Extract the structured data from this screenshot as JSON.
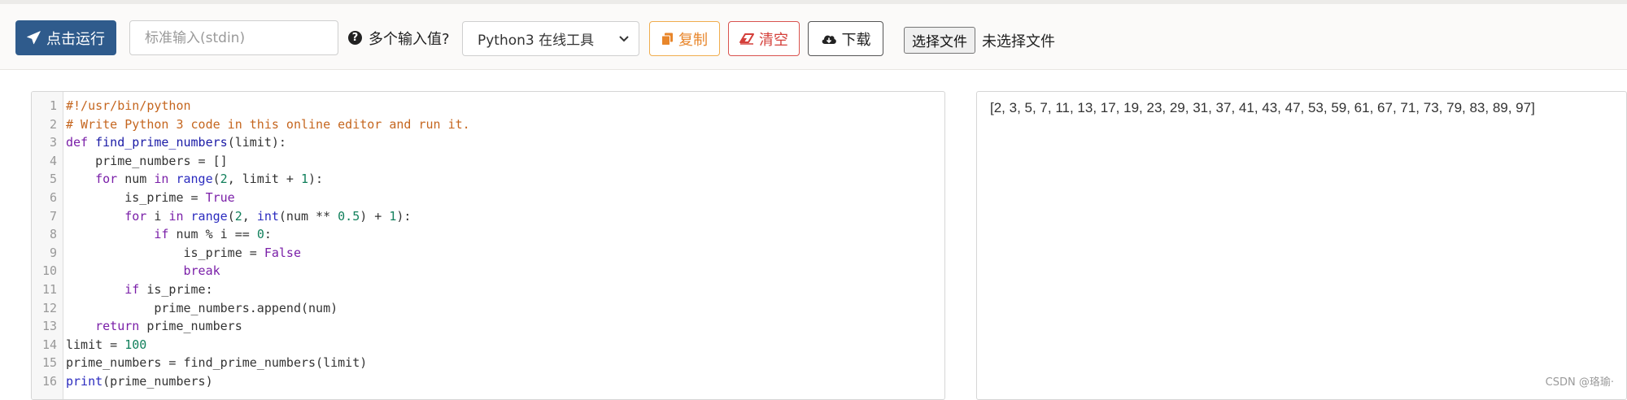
{
  "toolbar": {
    "run_label": "点击运行",
    "stdin_placeholder": "标准输入(stdin)",
    "multi_input_label": "多个输入值?",
    "language_selected": "Python3 在线工具",
    "copy_label": "复制",
    "clear_label": "清空",
    "download_label": "下载",
    "file_button_label": "选择文件",
    "file_status": "未选择文件"
  },
  "editor": {
    "lines": [
      {
        "n": "1",
        "tokens": [
          {
            "t": "#!/usr/bin/python",
            "c": "comment"
          }
        ]
      },
      {
        "n": "2",
        "tokens": [
          {
            "t": "# Write Python 3 code in this online editor and run it.",
            "c": "comment"
          }
        ]
      },
      {
        "n": "3",
        "tokens": [
          {
            "t": "def ",
            "c": "keyword"
          },
          {
            "t": "find_prime_numbers",
            "c": "def"
          },
          {
            "t": "(limit):",
            "c": ""
          }
        ]
      },
      {
        "n": "4",
        "tokens": [
          {
            "t": "    prime_numbers = []",
            "c": ""
          }
        ]
      },
      {
        "n": "5",
        "tokens": [
          {
            "t": "    ",
            "c": ""
          },
          {
            "t": "for",
            "c": "keyword"
          },
          {
            "t": " num ",
            "c": ""
          },
          {
            "t": "in",
            "c": "keyword"
          },
          {
            "t": " ",
            "c": ""
          },
          {
            "t": "range",
            "c": "builtin"
          },
          {
            "t": "(",
            "c": ""
          },
          {
            "t": "2",
            "c": "number"
          },
          {
            "t": ", limit + ",
            "c": ""
          },
          {
            "t": "1",
            "c": "number"
          },
          {
            "t": "):",
            "c": ""
          }
        ]
      },
      {
        "n": "6",
        "tokens": [
          {
            "t": "        is_prime = ",
            "c": ""
          },
          {
            "t": "True",
            "c": "keyword"
          }
        ]
      },
      {
        "n": "7",
        "tokens": [
          {
            "t": "        ",
            "c": ""
          },
          {
            "t": "for",
            "c": "keyword"
          },
          {
            "t": " i ",
            "c": ""
          },
          {
            "t": "in",
            "c": "keyword"
          },
          {
            "t": " ",
            "c": ""
          },
          {
            "t": "range",
            "c": "builtin"
          },
          {
            "t": "(",
            "c": ""
          },
          {
            "t": "2",
            "c": "number"
          },
          {
            "t": ", ",
            "c": ""
          },
          {
            "t": "int",
            "c": "builtin"
          },
          {
            "t": "(num ** ",
            "c": ""
          },
          {
            "t": "0.5",
            "c": "number"
          },
          {
            "t": ") + ",
            "c": ""
          },
          {
            "t": "1",
            "c": "number"
          },
          {
            "t": "):",
            "c": ""
          }
        ]
      },
      {
        "n": "8",
        "tokens": [
          {
            "t": "            ",
            "c": ""
          },
          {
            "t": "if",
            "c": "keyword"
          },
          {
            "t": " num % i == ",
            "c": ""
          },
          {
            "t": "0",
            "c": "number"
          },
          {
            "t": ":",
            "c": ""
          }
        ]
      },
      {
        "n": "9",
        "tokens": [
          {
            "t": "                is_prime = ",
            "c": ""
          },
          {
            "t": "False",
            "c": "keyword"
          }
        ]
      },
      {
        "n": "10",
        "tokens": [
          {
            "t": "                ",
            "c": ""
          },
          {
            "t": "break",
            "c": "keyword"
          }
        ]
      },
      {
        "n": "11",
        "tokens": [
          {
            "t": "        ",
            "c": ""
          },
          {
            "t": "if",
            "c": "keyword"
          },
          {
            "t": " is_prime:",
            "c": ""
          }
        ]
      },
      {
        "n": "12",
        "tokens": [
          {
            "t": "            prime_numbers.append(num)",
            "c": ""
          }
        ]
      },
      {
        "n": "13",
        "tokens": [
          {
            "t": "    ",
            "c": ""
          },
          {
            "t": "return",
            "c": "keyword"
          },
          {
            "t": " prime_numbers",
            "c": ""
          }
        ]
      },
      {
        "n": "14",
        "tokens": [
          {
            "t": "limit = ",
            "c": ""
          },
          {
            "t": "100",
            "c": "number"
          }
        ]
      },
      {
        "n": "15",
        "tokens": [
          {
            "t": "prime_numbers = find_prime_numbers(limit)",
            "c": ""
          }
        ]
      },
      {
        "n": "16",
        "tokens": [
          {
            "t": "print",
            "c": "builtin"
          },
          {
            "t": "(prime_numbers)",
            "c": ""
          }
        ]
      }
    ]
  },
  "output": {
    "text": "[2, 3, 5, 7, 11, 13, 17, 19, 23, 29, 31, 37, 41, 43, 47, 53, 59, 61, 67, 71, 73, 79, 83, 89, 97]"
  },
  "watermark": "CSDN @珞瑜·",
  "colors": {
    "run_button": "#2f5b8c",
    "copy_accent": "#e8862b",
    "clear_accent": "#d43f3a"
  },
  "icons": {
    "run": "paper-plane-icon",
    "help": "question-circle-icon",
    "dropdown": "chevron-down-icon",
    "copy": "copy-icon",
    "clear": "eraser-icon",
    "download": "cloud-download-icon"
  }
}
